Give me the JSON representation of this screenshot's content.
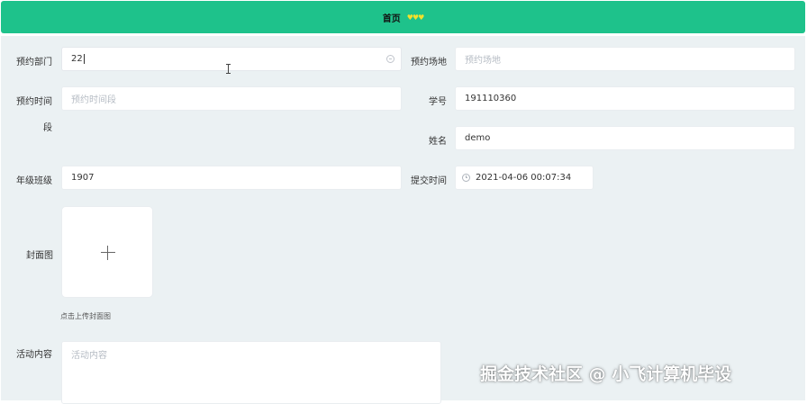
{
  "header": {
    "breadcrumb_home": "首页",
    "hearts": "♥♥♥"
  },
  "form": {
    "dept": {
      "label": "预约部门",
      "value": "22"
    },
    "venue": {
      "label": "预约场地",
      "placeholder": "预约场地"
    },
    "timeslot": {
      "label_line1": "预约时间",
      "label_line2": "段",
      "placeholder": "预约时间段"
    },
    "student_no": {
      "label": "学号",
      "value": "191110360"
    },
    "name": {
      "label": "姓名",
      "value": "demo"
    },
    "class": {
      "label": "年级班级",
      "value": "1907"
    },
    "submit_time": {
      "label": "提交时间",
      "value": "2021-04-06 00:07:34"
    },
    "cover": {
      "label": "封面图",
      "tip": "点击上传封面图"
    },
    "content": {
      "label": "活动内容",
      "placeholder": "活动内容"
    }
  },
  "watermark": "掘金技术社区 @ 小飞计算机毕设",
  "colors": {
    "header_green": "#1ec28b",
    "panel_bg": "#ebf1f3"
  },
  "icons": [
    "clear-icon",
    "clock-icon",
    "plus-icon",
    "text-cursor-icon",
    "heart-icon"
  ]
}
